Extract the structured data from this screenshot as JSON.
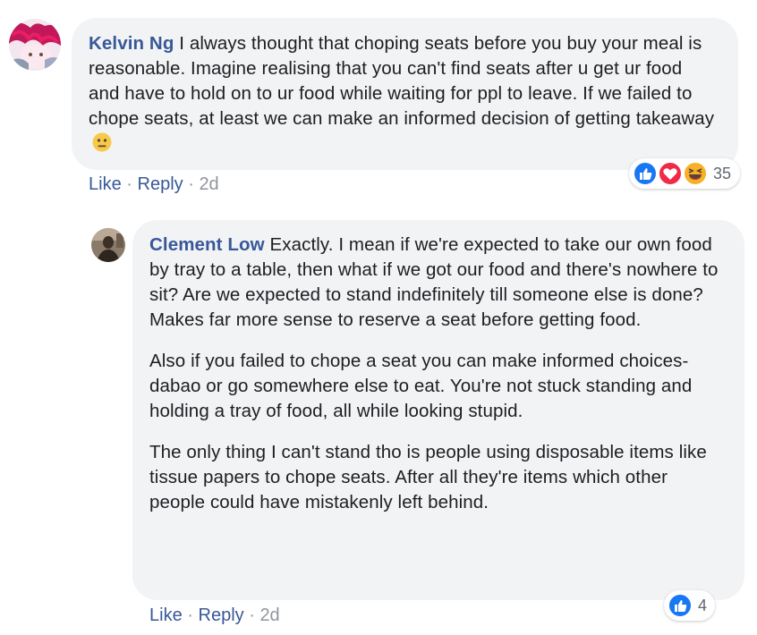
{
  "comments": [
    {
      "author": "Kelvin Ng",
      "text": "I always thought that choping seats before you buy your meal is reasonable. Imagine realising that you can't find seats after u get ur food and have to hold on to ur food while waiting for ppl to leave. If we failed to chope seats, at least we can make an informed decision of getting takeaway",
      "emoji": "neutral-face-emoji",
      "actions": {
        "like": "Like",
        "separator": "·",
        "reply": "Reply",
        "time": "2d"
      },
      "reactions": {
        "icons": [
          "like-icon",
          "love-icon",
          "haha-icon"
        ],
        "count": "35"
      },
      "colors": {
        "like": "#1877f2",
        "love": "#f0284a",
        "haha": "#f7b125"
      }
    },
    {
      "author": "Clement Low",
      "paragraphs": [
        "Exactly. I mean if we're expected to take our own food by tray to a table, then what if we got our food and there's nowhere to sit? Are we expected to stand indefinitely till someone else is done? Makes far more sense to reserve a seat before getting food.",
        "Also if you failed to chope a seat you can make informed choices-dabao or go somewhere else to eat. You're not stuck standing and holding a tray of food, all while looking stupid.",
        "The only thing I can't stand tho is people using disposable items like tissue papers to chope seats. After all they're items which other people could have mistakenly left behind."
      ],
      "actions": {
        "like": "Like",
        "separator": "·",
        "reply": "Reply",
        "time": "2d"
      },
      "reactions": {
        "icons": [
          "like-icon"
        ],
        "count": "4"
      }
    }
  ],
  "colors": {
    "author_name": "#385898",
    "bubble_bg": "#f2f3f5",
    "meta_gray": "#90949c"
  }
}
